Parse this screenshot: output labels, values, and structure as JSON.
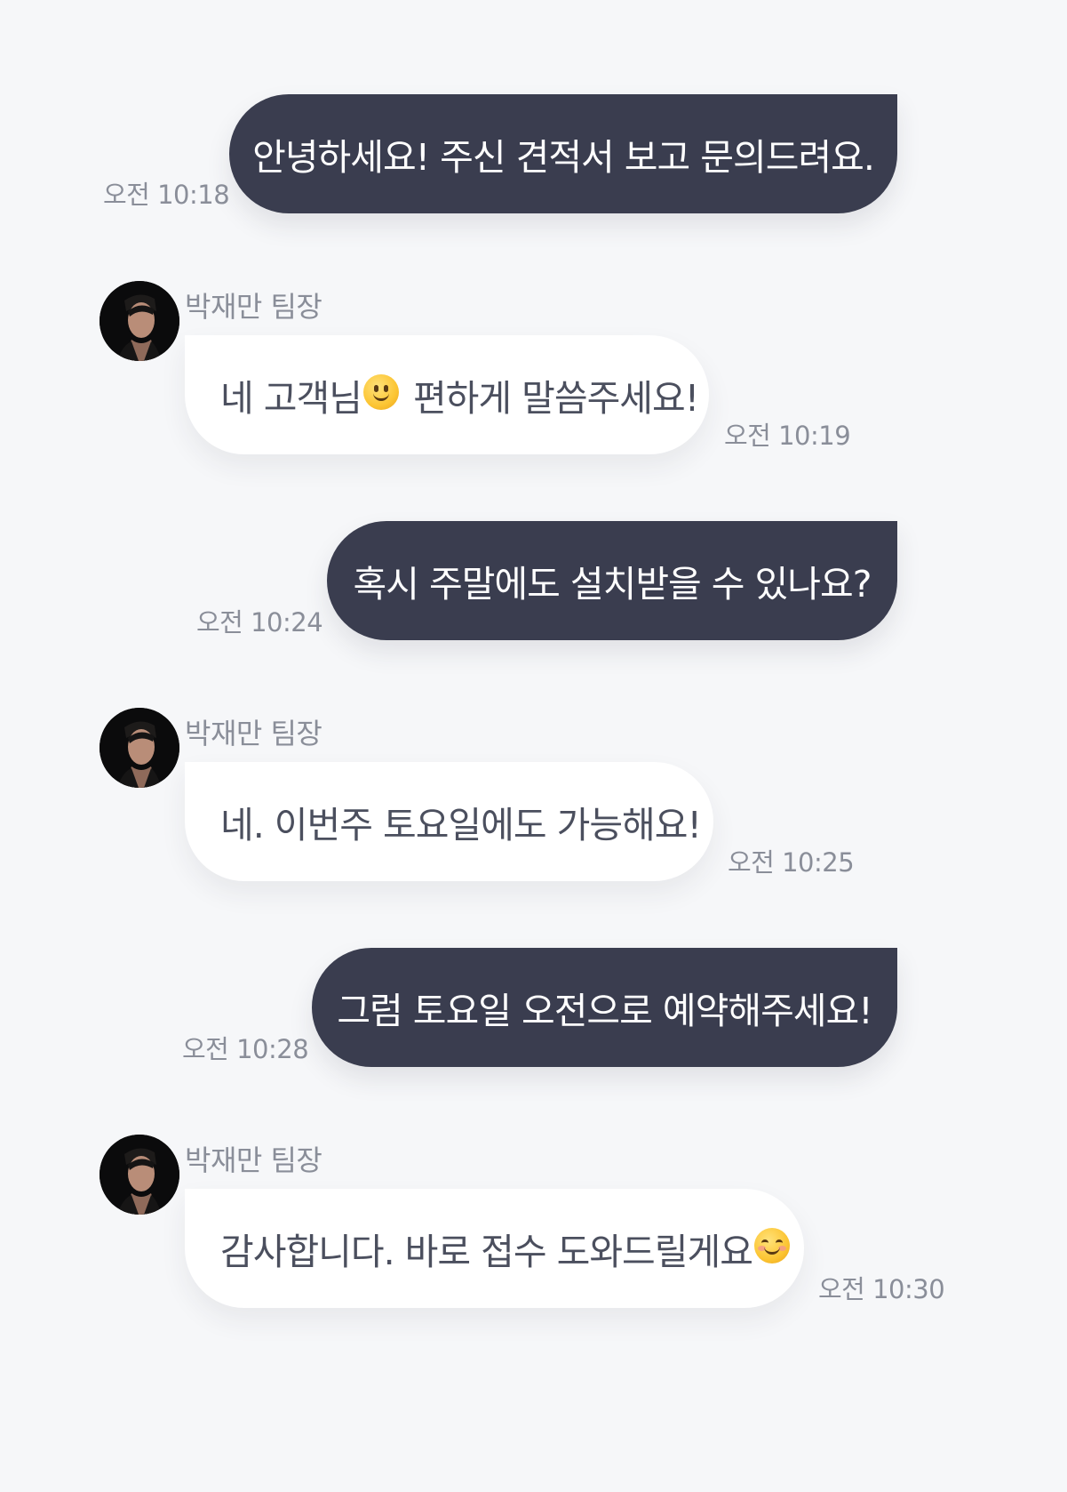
{
  "messages": [
    {
      "text": "안녕하세요! 주신 견적서 보고 문의드려요.",
      "time": "오전 10:18"
    },
    {
      "sender": "박재만 팀장",
      "text_before": "네 고객님",
      "emoji": "slightly-smiling-face-emoji",
      "text_after": " 편하게 말씀주세요!",
      "time": "오전 10:19"
    },
    {
      "text": "혹시 주말에도 설치받을 수 있나요?",
      "time": "오전 10:24"
    },
    {
      "sender": "박재만 팀장",
      "text": "네. 이번주 토요일에도 가능해요!",
      "time": "오전 10:25"
    },
    {
      "text": "그럼 토요일 오전으로 예약해주세요!",
      "time": "오전 10:28"
    },
    {
      "sender": "박재만 팀장",
      "text": "감사합니다. 바로 접수 도와드릴게요",
      "emoji": "smiling-face-with-smiling-eyes-emoji",
      "time": "오전 10:30"
    }
  ],
  "colors": {
    "background": "#f6f7f9",
    "sent_bubble": "#3a3d4f",
    "received_bubble": "#ffffff",
    "received_text": "#4b4f5e",
    "meta_text": "#8a8e99"
  }
}
